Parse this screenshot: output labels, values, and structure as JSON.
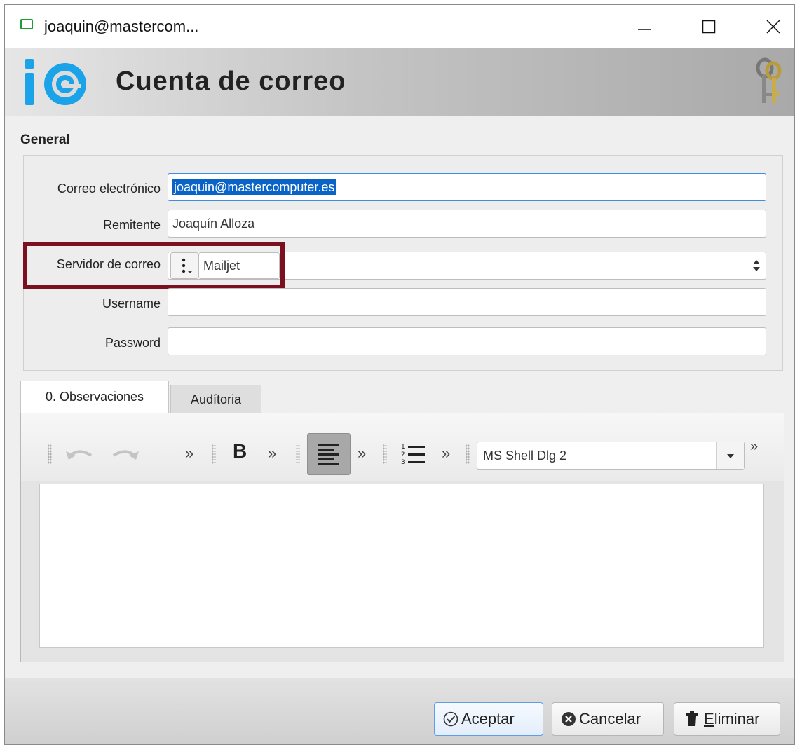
{
  "window": {
    "title": "joaquin@mastercom...",
    "controls": [
      "minimize-icon",
      "maximize-icon",
      "close-icon"
    ]
  },
  "header": {
    "title": "Cuenta de correo",
    "logo_icon": "io-logo-icon",
    "badge_icon": "keys-icon"
  },
  "general": {
    "section_title": "General",
    "fields": {
      "email": {
        "label": "Correo electrónico",
        "value": "joaquin@mastercomputer.es"
      },
      "sender": {
        "label": "Remitente",
        "value": "Joaquín Alloza"
      },
      "server": {
        "label": "Servidor de correo",
        "value": "Mailjet"
      },
      "username": {
        "label": "Username",
        "value": ""
      },
      "password": {
        "label": "Password",
        "value": ""
      }
    }
  },
  "tabs": {
    "observaciones_prefix": "0",
    "observaciones_rest": ". Observaciones",
    "auditoria": "Audítoria"
  },
  "toolbar": {
    "font": "MS Shell Dlg 2",
    "overflow": "»",
    "bold": "B"
  },
  "footer": {
    "accept": "Aceptar",
    "cancel": "Cancelar",
    "delete_mnemonic": "E",
    "delete_rest": "liminar"
  },
  "colors": {
    "selection": "#0a64c8",
    "highlight_frame": "#7a1020",
    "logo_blue": "#1aa3e8"
  }
}
